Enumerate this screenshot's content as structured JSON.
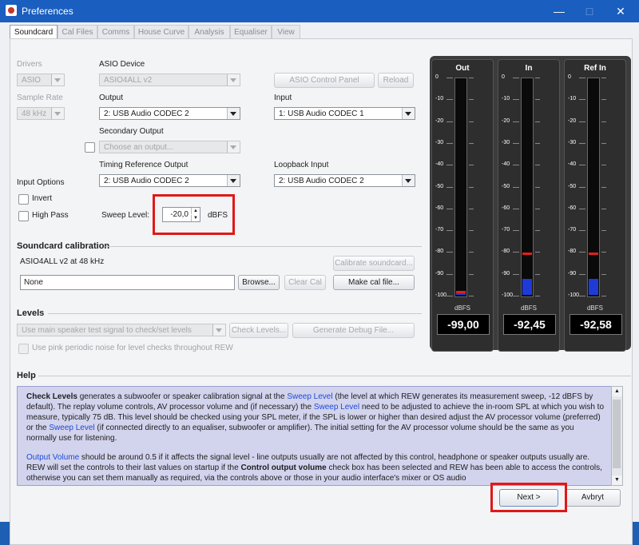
{
  "window": {
    "title": "Preferences",
    "minimize": "—",
    "maximize": "□",
    "close": "✕",
    "icon": "rew-app-icon"
  },
  "tabs": [
    {
      "label": "Soundcard"
    },
    {
      "label": "Cal Files"
    },
    {
      "label": "Comms"
    },
    {
      "label": "House Curve"
    },
    {
      "label": "Analysis"
    },
    {
      "label": "Equaliser"
    },
    {
      "label": "View"
    }
  ],
  "drivers": {
    "label": "Drivers",
    "value": "ASIO"
  },
  "sample_rate": {
    "label": "Sample Rate",
    "value": "48 kHz"
  },
  "asio_device": {
    "label": "ASIO Device",
    "value": "ASIO4ALL v2"
  },
  "asio_control_panel": "ASIO Control Panel",
  "reload": "Reload",
  "output": {
    "label": "Output",
    "value": "2: USB Audio CODEC  2"
  },
  "input": {
    "label": "Input",
    "value": "1: USB Audio CODEC  1"
  },
  "secondary_output": {
    "label": "Secondary Output",
    "placeholder": "Choose an output..."
  },
  "timing_ref": {
    "label": "Timing Reference Output",
    "value": "2: USB Audio CODEC  2"
  },
  "loopback": {
    "label": "Loopback Input",
    "value": "2: USB Audio CODEC  2"
  },
  "input_options": {
    "label": "Input Options",
    "invert": "Invert",
    "high_pass": "High Pass"
  },
  "sweep": {
    "label": "Sweep Level:",
    "value": "-20,0",
    "unit": "dBFS"
  },
  "calibration": {
    "title": "Soundcard calibration",
    "info": "ASIO4ALL v2 at 48 kHz",
    "file": "None",
    "browse": "Browse...",
    "clear": "Clear Cal",
    "calibrate": "Calibrate soundcard...",
    "make": "Make cal file..."
  },
  "levels": {
    "title": "Levels",
    "select": "Use main speaker test signal to check/set levels",
    "check": "Check Levels...",
    "debug": "Generate Debug File...",
    "pink": "Use pink periodic noise for level checks throughout REW"
  },
  "meters": {
    "unit": "dBFS",
    "ticks": [
      "0",
      "-10",
      "-20",
      "-30",
      "-40",
      "-50",
      "-60",
      "-70",
      "-80",
      "-90",
      "-100"
    ],
    "items": [
      {
        "title": "Out",
        "value": "-99,00",
        "level_db": -99,
        "peak_db": -99
      },
      {
        "title": "In",
        "value": "-92,45",
        "level_db": -92.45,
        "peak_db": -81
      },
      {
        "title": "Ref In",
        "value": "-92,58",
        "level_db": -92.58,
        "peak_db": -81
      }
    ]
  },
  "help": {
    "title": "Help",
    "p1": [
      {
        "t": "Check Levels",
        "b": true
      },
      {
        "t": " generates a subwoofer or speaker calibration signal at the "
      },
      {
        "t": "Sweep Level",
        "l": true
      },
      {
        "t": " (the level at which REW generates its measurement sweep, -12 dBFS by default). The replay volume controls, AV processor volume and (if necessary) the "
      },
      {
        "t": "Sweep Level",
        "l": true
      },
      {
        "t": " need to be adjusted to achieve the in-room SPL at which you wish to measure, typically 75 dB. This level should be checked using your SPL meter, if the SPL is lower or higher than desired adjust the AV processor volume (preferred) or the "
      },
      {
        "t": "Sweep Level",
        "l": true
      },
      {
        "t": " (if connected directly to an equaliser, subwoofer or amplifier). The initial setting for the AV processor volume should be the same as you normally use for listening."
      }
    ],
    "p2": [
      {
        "t": "Output Volume",
        "l": true
      },
      {
        "t": " should be around 0.5 if it affects the signal level - line outputs usually are not affected by this control, headphone or speaker outputs usually are. REW will set the controls to their last values on startup if the "
      },
      {
        "t": "Control output volume",
        "b": true
      },
      {
        "t": " check box has been selected and REW has been able to access the controls, otherwise you can set them manually as required, via the controls above or those in your audio interface's mixer or OS audio"
      }
    ]
  },
  "footer": {
    "next": "Next >",
    "cancel": "Avbryt"
  }
}
